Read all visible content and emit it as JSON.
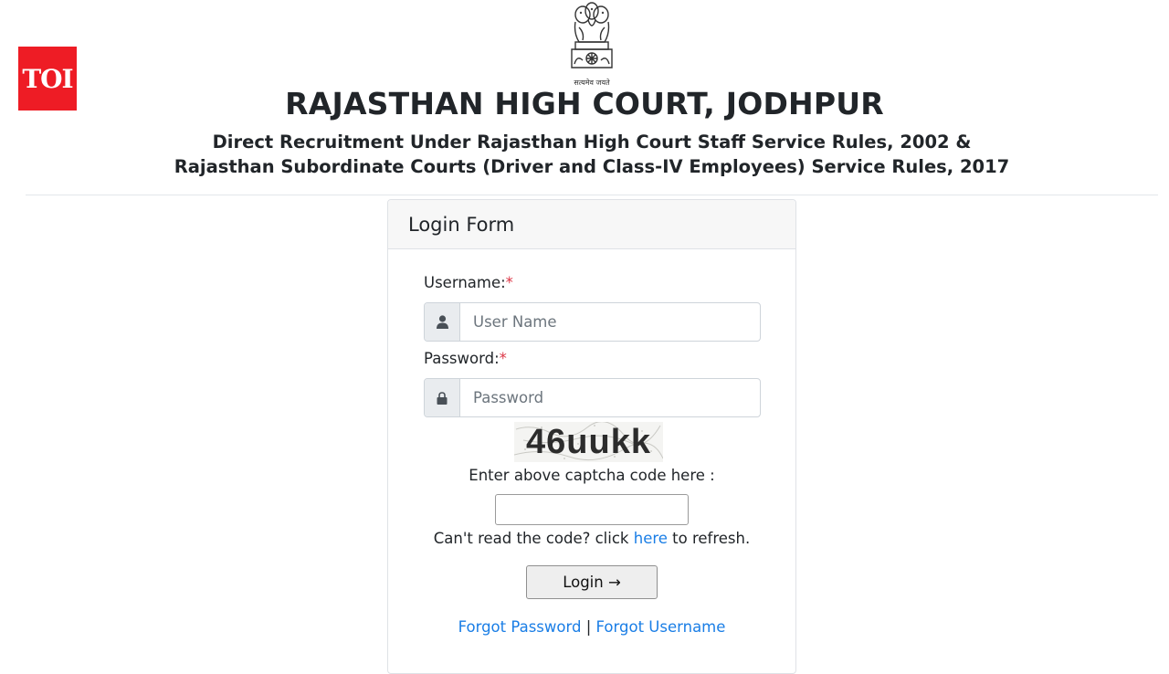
{
  "branding": {
    "toi_logo": "TOI",
    "emblem_icon": "ashoka-emblem-icon",
    "emblem_motto": "सत्यमेव जयते"
  },
  "header": {
    "title": "RAJASTHAN HIGH COURT, JODHPUR",
    "subtitle_line1": "Direct Recruitment Under Rajasthan High Court Staff Service Rules, 2002 &",
    "subtitle_line2": "Rajasthan Subordinate Courts (Driver and Class-IV Employees) Service Rules, 2017"
  },
  "login_form": {
    "title": "Login Form",
    "username": {
      "label": "Username:",
      "required_mark": "*",
      "placeholder": "User Name",
      "value": "",
      "icon": "user-icon"
    },
    "password": {
      "label": "Password:",
      "required_mark": "*",
      "placeholder": "Password",
      "value": "",
      "icon": "lock-icon"
    },
    "captcha": {
      "code": "46uukk",
      "instruction": "Enter above captcha code here :",
      "value": "",
      "refresh_prefix": "Can't read the code? click ",
      "refresh_link": "here",
      "refresh_suffix": " to refresh."
    },
    "login_button": "Login →",
    "forgot_password": "Forgot Password",
    "separator": "|",
    "forgot_username": "Forgot Username"
  },
  "colors": {
    "toi_red": "#ee1c25",
    "link_blue": "#1a7ee6",
    "required_red": "#dc3545"
  }
}
